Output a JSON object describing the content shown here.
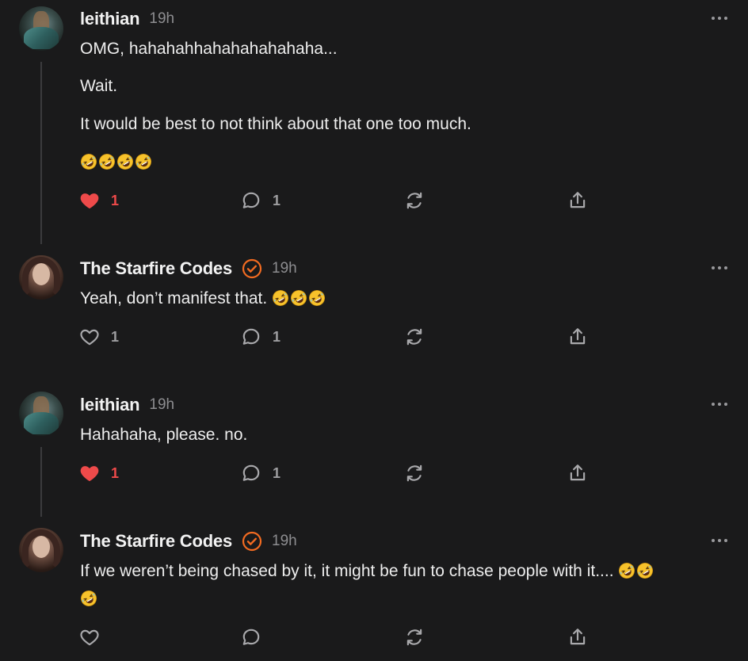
{
  "colors": {
    "background": "#1a1a1b",
    "text": "#ededed",
    "muted": "#8d8d90",
    "liked": "#ee4a4a",
    "verified": "#f26b21",
    "thread_line": "#3b3b3d"
  },
  "icons": {
    "like": "heart-icon",
    "reply": "speech-bubble-icon",
    "restack": "restack-arrows-icon",
    "share": "share-upload-icon",
    "more": "ellipsis-icon",
    "verified": "verified-check-icon",
    "emoji": "rolling-on-floor-laughing-emoji"
  },
  "comments": [
    {
      "author": "leithian",
      "time": "19h",
      "verified": false,
      "paragraphs": [
        "OMG, hahahahhahahahahahaha...",
        "Wait.",
        "It would be best to not think about that one too much."
      ],
      "emoji_count": 4,
      "liked": true,
      "like_count": "1",
      "reply_count": "1"
    },
    {
      "author": "The Starfire Codes",
      "time": "19h",
      "verified": true,
      "text": "Yeah, don’t manifest that.",
      "emoji_count": 3,
      "liked": false,
      "like_count": "1",
      "reply_count": "1"
    },
    {
      "author": "leithian",
      "time": "19h",
      "verified": false,
      "text": "Hahahaha, please. no.",
      "liked": true,
      "like_count": "1",
      "reply_count": "1"
    },
    {
      "author": "The Starfire Codes",
      "time": "19h",
      "verified": true,
      "text": "If we weren’t being chased by it, it might be fun to chase people with it....",
      "emoji_count": 3,
      "liked": false,
      "like_count": "",
      "reply_count": ""
    }
  ]
}
